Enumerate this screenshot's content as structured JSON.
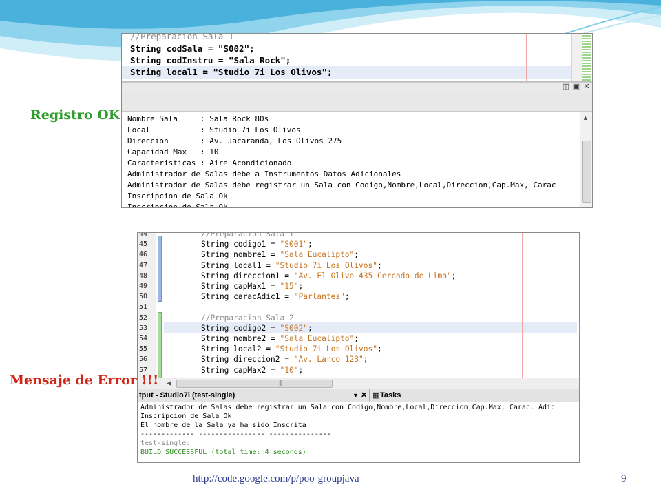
{
  "theme": {
    "wave_light": "#bfe6f4",
    "wave_mid": "#7fcbe8",
    "wave_dark": "#3aa6d4",
    "ok_color": "#2e9d2e",
    "error_color": "#d0261a",
    "string_color": "#c8741f"
  },
  "panel1": {
    "code_lines": [
      "//Preparacion Sala 1",
      "String codSala = \"S002\";",
      "String codInstru = \"Sala Rock\";",
      "String local1 = \"Studio 7i Los Olivos\";"
    ],
    "output_lines": [
      "Nombre Sala     : Sala Rock 80s",
      "Local           : Studio 7i Los Olivos",
      "Direccion       : Av. Jacaranda, Los Olivos 275",
      "Capacidad Max   : 10",
      "Caracteristicas : Aire Acondicionado",
      "Administrador de Salas debe a Instrumentos Datos Adicionales",
      "Administrador de Salas debe registrar un Sala con Codigo,Nombre,Local,Direccion,Cap.Max, Carac",
      "Inscripcion de Sala Ok",
      "Inscripcion de Sala Ok"
    ],
    "bar_icons": [
      "maximize-icon",
      "restore-icon",
      "close-icon"
    ]
  },
  "panel2": {
    "line_numbers": [
      "44",
      "45",
      "46",
      "47",
      "48",
      "49",
      "50",
      "51",
      "52",
      "53",
      "54",
      "55",
      "56",
      "57"
    ],
    "code_lines": [
      {
        "pre": "//Preparacion Sala 1",
        "str": "",
        "post": "",
        "comment": true
      },
      {
        "pre": "String codigo1 = ",
        "str": "\"S001\"",
        "post": ";"
      },
      {
        "pre": "String nombre1 = ",
        "str": "\"Sala Eucalipto\"",
        "post": ";"
      },
      {
        "pre": "String local1 = ",
        "str": "\"Studio 7i Los Olivos\"",
        "post": ";"
      },
      {
        "pre": "String direccion1 = ",
        "str": "\"Av. El Olivo 435 Cercado de Lima\"",
        "post": ";"
      },
      {
        "pre": "String capMax1 = ",
        "str": "\"15\"",
        "post": ";"
      },
      {
        "pre": "String caracAdic1 = ",
        "str": "\"Parlantes\"",
        "post": ";"
      },
      {
        "pre": "",
        "str": "",
        "post": ""
      },
      {
        "pre": "//Preparacion Sala 2",
        "str": "",
        "post": "",
        "comment": true
      },
      {
        "pre": "String codigo2 = ",
        "str": "\"S002\"",
        "post": ";"
      },
      {
        "pre": "String nombre2 = ",
        "str": "\"Sala Eucalipto\"",
        "post": ";"
      },
      {
        "pre": "String local2 = ",
        "str": "\"Studio 7i Los Olivos\"",
        "post": ";"
      },
      {
        "pre": "String direccion2 = ",
        "str": "\"Av. Larco 123\"",
        "post": ";"
      },
      {
        "pre": "String capMax2 = ",
        "str": "\"10\"",
        "post": ";"
      }
    ],
    "output_tab": "tput - Studio7i (test-single)",
    "tasks_tab": "Tasks",
    "output_lines": [
      {
        "text": "Administrador de Salas debe registrar un Sala con Codigo,Nombre,Local,Direccion,Cap.Max, Carac. Adic",
        "cls": ""
      },
      {
        "text": "Inscripcion de Sala Ok",
        "cls": ""
      },
      {
        "text": "El nombre de la Sala ya ha sido Inscrita",
        "cls": ""
      },
      {
        "text": "------------- ---------------- ---------------",
        "cls": ""
      },
      {
        "text": "test-single:",
        "cls": "gray"
      },
      {
        "text": "BUILD SUCCESSFUL (total time: 4 seconds)",
        "cls": "green"
      }
    ]
  },
  "labels": {
    "ok": "Registro OK",
    "error": "Mensaje de Error !!!"
  },
  "footer": {
    "url": "http://code.google.com/p/poo-groupjava",
    "page": "9"
  }
}
